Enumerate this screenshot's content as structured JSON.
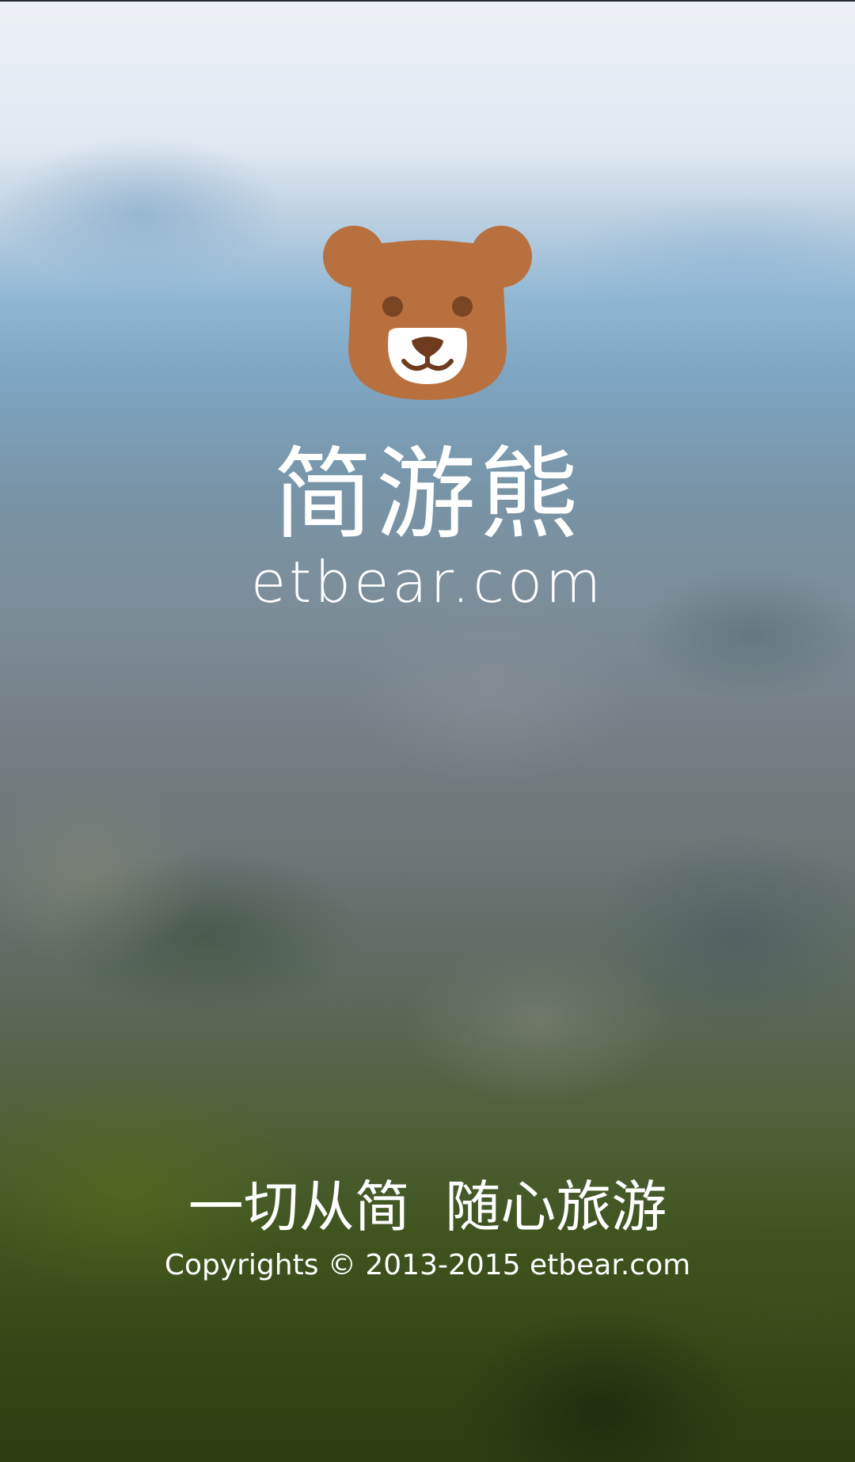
{
  "app": {
    "name": "简游熊",
    "domain": "etbear.com",
    "slogan": "一切从简  随心旅游",
    "copyright": "Copyrights © 2013-2015 etbear.com"
  },
  "logo": {
    "icon": "bear-face-icon",
    "head_color": "#b9703f",
    "eye_color": "#7a4523",
    "muzzle_color": "#ffffff",
    "nose_color": "#6e3b1f"
  },
  "colors": {
    "text": "#ffffff"
  }
}
